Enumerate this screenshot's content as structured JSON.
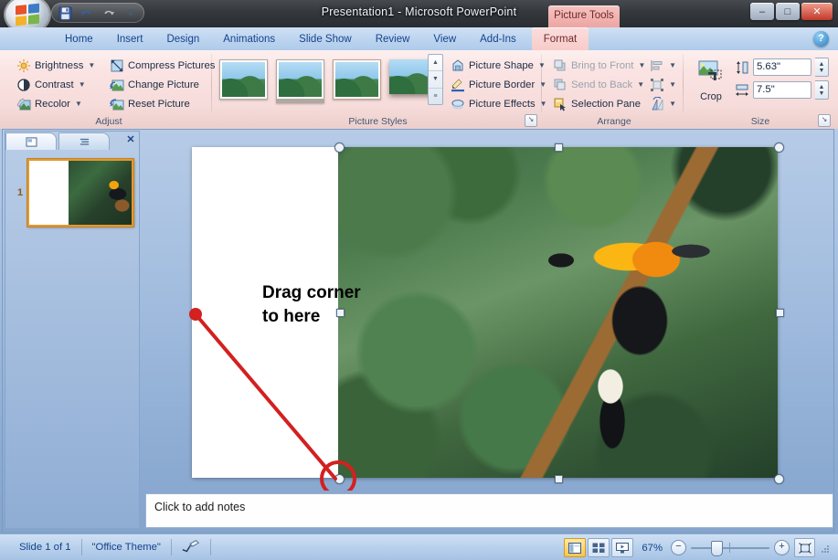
{
  "window": {
    "title": "Presentation1 - Microsoft PowerPoint",
    "contextual_tab_label": "Picture Tools",
    "minimize": "–",
    "maximize": "□",
    "close": "✕"
  },
  "quick_access": {
    "items": [
      {
        "name": "save-icon",
        "label": "Save"
      },
      {
        "name": "undo-icon",
        "label": "Undo"
      },
      {
        "name": "redo-icon",
        "label": "Redo"
      },
      {
        "name": "customize-qat-icon",
        "label": "Customize Quick Access Toolbar"
      }
    ]
  },
  "tabs": [
    {
      "label": "Home",
      "active": false
    },
    {
      "label": "Insert",
      "active": false
    },
    {
      "label": "Design",
      "active": false
    },
    {
      "label": "Animations",
      "active": false
    },
    {
      "label": "Slide Show",
      "active": false
    },
    {
      "label": "Review",
      "active": false
    },
    {
      "label": "View",
      "active": false
    },
    {
      "label": "Add-Ins",
      "active": false
    },
    {
      "label": "Format",
      "active": true
    }
  ],
  "help": {
    "label": "?"
  },
  "ribbon": {
    "groups": {
      "adjust": {
        "title": "Adjust",
        "buttons": [
          {
            "label": "Brightness",
            "has_caret": true,
            "icon": "brightness-icon"
          },
          {
            "label": "Contrast",
            "has_caret": true,
            "icon": "contrast-icon"
          },
          {
            "label": "Recolor",
            "has_caret": true,
            "icon": "recolor-icon"
          },
          {
            "label": "Compress Pictures",
            "has_caret": false,
            "icon": "compress-pictures-icon"
          },
          {
            "label": "Change Picture",
            "has_caret": false,
            "icon": "change-picture-icon"
          },
          {
            "label": "Reset Picture",
            "has_caret": false,
            "icon": "reset-picture-icon"
          }
        ]
      },
      "picture_styles": {
        "title": "Picture Styles",
        "gallery_count": 4,
        "scroll": {
          "up": "▲",
          "down": "▼",
          "more": "≡"
        },
        "buttons": [
          {
            "label": "Picture Shape",
            "has_caret": true,
            "icon": "picture-shape-icon"
          },
          {
            "label": "Picture Border",
            "has_caret": true,
            "icon": "picture-border-icon"
          },
          {
            "label": "Picture Effects",
            "has_caret": true,
            "icon": "picture-effects-icon"
          }
        ],
        "dialog_launcher": "↘"
      },
      "arrange": {
        "title": "Arrange",
        "buttons": [
          {
            "label": "Bring to Front",
            "has_caret": true,
            "disabled": true,
            "icon": "bring-to-front-icon"
          },
          {
            "label": "Send to Back",
            "has_caret": true,
            "disabled": true,
            "icon": "send-to-back-icon"
          },
          {
            "label": "Selection Pane",
            "has_caret": false,
            "disabled": false,
            "icon": "selection-pane-icon"
          }
        ],
        "side_buttons": [
          {
            "name": "align-icon",
            "has_caret": true,
            "disabled": true
          },
          {
            "name": "group-icon",
            "has_caret": true,
            "disabled": true
          },
          {
            "name": "rotate-icon",
            "has_caret": true,
            "disabled": false
          }
        ]
      },
      "size": {
        "title": "Size",
        "crop_label": "Crop",
        "height_value": "5.63\"",
        "width_value": "7.5\"",
        "height_icon": "shape-height-icon",
        "width_icon": "shape-width-icon",
        "dialog_launcher": "↘"
      }
    }
  },
  "slides_pane": {
    "tabs": [
      {
        "name": "slides-tab",
        "label": "Slides",
        "active": true
      },
      {
        "name": "outline-tab",
        "label": "Outline",
        "active": false
      }
    ],
    "close_label": "✕",
    "thumbnails": [
      {
        "number": "1"
      }
    ]
  },
  "slide": {
    "annotation_line1": "Drag corner",
    "annotation_line2": "to here",
    "photo_alt": "toucan-photo",
    "annotation_color": "#d32020",
    "selection_handle_count": 8
  },
  "notes": {
    "placeholder": "Click to add notes"
  },
  "statusbar": {
    "slide_count_text": "Slide 1 of 1",
    "theme_text": "\"Office Theme\"",
    "spellcheck_icon": "spellcheck-icon",
    "zoom_level": "67%",
    "zoom_out": "−",
    "zoom_in": "+",
    "views": [
      {
        "name": "normal-view-button",
        "active": true
      },
      {
        "name": "slide-sorter-view-button",
        "active": false
      },
      {
        "name": "slide-show-view-button",
        "active": false
      }
    ],
    "fit_button": "fit-slide-to-window-button"
  },
  "colors": {
    "contextual_accent": "#f7cbc9",
    "ribbon_bg": "#fae4e3",
    "tab_blue": "#15428b",
    "annotation_red": "#d32020",
    "thumb_border": "#e09a33"
  }
}
